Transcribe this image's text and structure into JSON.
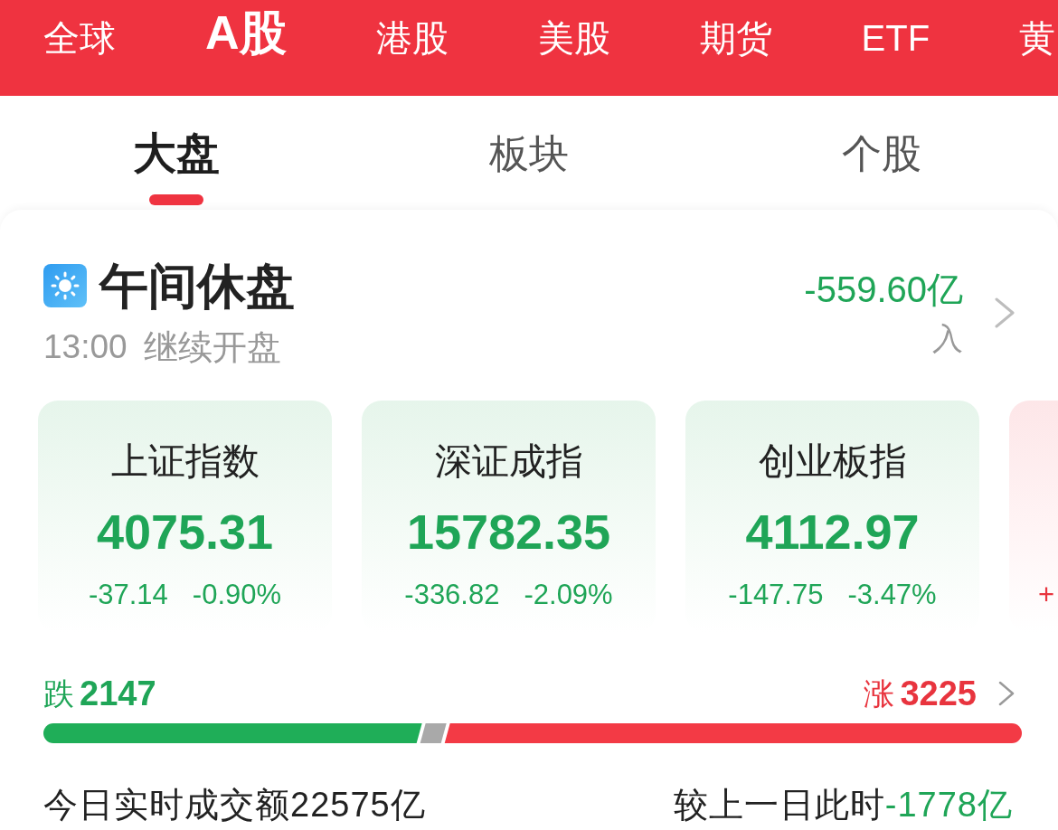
{
  "market_tabs": [
    {
      "label": "全球",
      "selected": false
    },
    {
      "label": "A股",
      "selected": true
    },
    {
      "label": "港股",
      "selected": false
    },
    {
      "label": "美股",
      "selected": false
    },
    {
      "label": "期货",
      "selected": false
    },
    {
      "label": "ETF",
      "selected": false
    },
    {
      "label": "黄",
      "selected": false
    }
  ],
  "sub_tabs": [
    {
      "label": "大盘",
      "selected": true
    },
    {
      "label": "板块",
      "selected": false
    },
    {
      "label": "个股",
      "selected": false
    }
  ],
  "session": {
    "title": "午间休盘",
    "resume_time": "13:00",
    "resume_status": "继续开盘",
    "net_flow": {
      "value": "-559.60亿",
      "kind": "down",
      "label": "入"
    }
  },
  "indices": [
    {
      "name": "上证指数",
      "value": "4075.31",
      "change": "-37.14",
      "percent": "-0.90%",
      "kind": "down"
    },
    {
      "name": "深证成指",
      "value": "15782.35",
      "change": "-336.82",
      "percent": "-2.09%",
      "kind": "down"
    },
    {
      "name": "创业板指",
      "value": "4112.97",
      "change": "-147.75",
      "percent": "-3.47%",
      "kind": "down"
    },
    {
      "change": "+",
      "kind": "up"
    }
  ],
  "breadth": {
    "fall_label": "跌",
    "fall_count": "2147",
    "rise_label": "涨",
    "rise_count": "3225",
    "segments": [
      {
        "kind": "fall",
        "level": 0.386
      },
      {
        "kind": "flat",
        "level": 0.025
      },
      {
        "kind": "rise",
        "level": 0.589
      }
    ]
  },
  "turnover": {
    "label": "今日实时成交额22575亿",
    "compare": {
      "label": "较上一日此时",
      "value": "-1778亿",
      "kind": "down"
    }
  }
}
